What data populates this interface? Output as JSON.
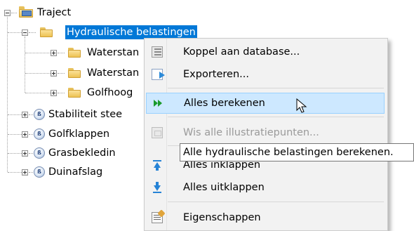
{
  "tree": {
    "root": {
      "label": "Traject",
      "expanded": true
    },
    "items": [
      {
        "label": "Hydraulische belastingen",
        "icon": "folder-icon",
        "expanded": true,
        "selected": true
      },
      {
        "label": "Waterstan",
        "icon": "folder-icon",
        "expanded": false
      },
      {
        "label": "Waterstan",
        "icon": "folder-icon",
        "expanded": false
      },
      {
        "label": "Golfhoog",
        "icon": "folder-icon",
        "expanded": false
      },
      {
        "label": "Stabiliteit stee",
        "icon": "failure-mechanism-icon",
        "expanded": false
      },
      {
        "label": "Golfklappen",
        "icon": "failure-mechanism-icon",
        "expanded": false
      },
      {
        "label": "Grasbekledin",
        "icon": "failure-mechanism-icon",
        "expanded": false
      },
      {
        "label": "Duinafslag",
        "icon": "failure-mechanism-icon",
        "expanded": false
      }
    ]
  },
  "context_menu": {
    "items": [
      {
        "label": "Koppel aan database...",
        "icon": "database-icon",
        "enabled": true
      },
      {
        "label": "Exporteren...",
        "icon": "export-icon",
        "enabled": true
      },
      {
        "label": "Alles berekenen",
        "icon": "run-all-icon",
        "enabled": true,
        "highlighted": true
      },
      {
        "label": "Wis alle illustratiepunten...",
        "icon": "clear-illustration-points-icon",
        "enabled": false
      },
      {
        "label": "Alles inklappen",
        "icon": "collapse-all-icon",
        "enabled": true
      },
      {
        "label": "Alles uitklappen",
        "icon": "expand-all-icon",
        "enabled": true
      },
      {
        "label": "Eigenschappen",
        "icon": "properties-icon",
        "enabled": true
      }
    ]
  },
  "tooltip": {
    "text": "Alle hydraulische belastingen berekenen."
  },
  "colors": {
    "selection": "#0078d7",
    "menu_highlight": "#cde8ff",
    "menu_highlight_border": "#99d1ff",
    "run_icon": "#1a9a2a"
  }
}
